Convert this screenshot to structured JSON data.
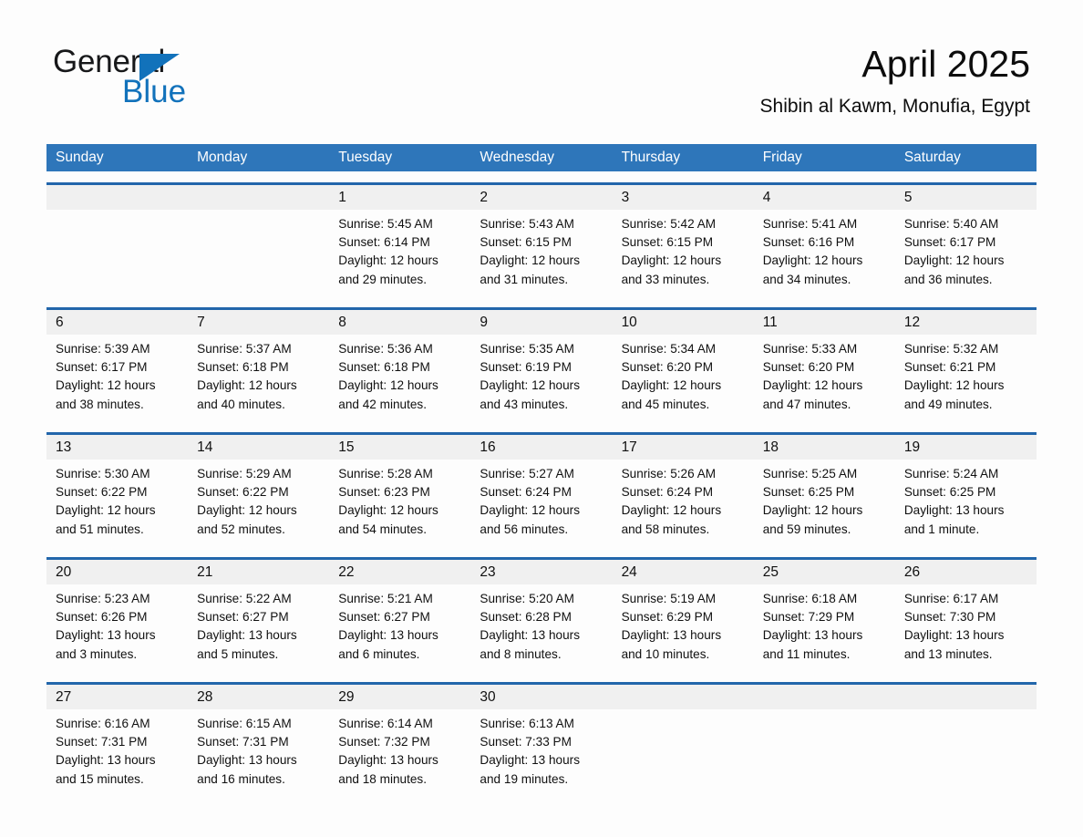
{
  "brand": {
    "name_part1": "General",
    "name_part2": "Blue",
    "accent_color": "#1272bb",
    "logo_icon": "triangle-flag-icon"
  },
  "header": {
    "title": "April 2025",
    "subtitle": "Shibin al Kawm, Monufia, Egypt"
  },
  "theme": {
    "header_bar_color": "#2e76ba",
    "week_rule_color": "#2266ab",
    "daynum_row_color": "#f0f0f0",
    "page_background": "#fdfdfd"
  },
  "weekdays": [
    "Sunday",
    "Monday",
    "Tuesday",
    "Wednesday",
    "Thursday",
    "Friday",
    "Saturday"
  ],
  "weeks": [
    {
      "days": [
        {
          "num": "",
          "l1": "",
          "l2": "",
          "l3": "",
          "l4": "",
          "empty": true
        },
        {
          "num": "",
          "l1": "",
          "l2": "",
          "l3": "",
          "l4": "",
          "empty": true
        },
        {
          "num": "1",
          "l1": "Sunrise: 5:45 AM",
          "l2": "Sunset: 6:14 PM",
          "l3": "Daylight: 12 hours",
          "l4": "and 29 minutes.",
          "empty": false
        },
        {
          "num": "2",
          "l1": "Sunrise: 5:43 AM",
          "l2": "Sunset: 6:15 PM",
          "l3": "Daylight: 12 hours",
          "l4": "and 31 minutes.",
          "empty": false
        },
        {
          "num": "3",
          "l1": "Sunrise: 5:42 AM",
          "l2": "Sunset: 6:15 PM",
          "l3": "Daylight: 12 hours",
          "l4": "and 33 minutes.",
          "empty": false
        },
        {
          "num": "4",
          "l1": "Sunrise: 5:41 AM",
          "l2": "Sunset: 6:16 PM",
          "l3": "Daylight: 12 hours",
          "l4": "and 34 minutes.",
          "empty": false
        },
        {
          "num": "5",
          "l1": "Sunrise: 5:40 AM",
          "l2": "Sunset: 6:17 PM",
          "l3": "Daylight: 12 hours",
          "l4": "and 36 minutes.",
          "empty": false
        }
      ]
    },
    {
      "days": [
        {
          "num": "6",
          "l1": "Sunrise: 5:39 AM",
          "l2": "Sunset: 6:17 PM",
          "l3": "Daylight: 12 hours",
          "l4": "and 38 minutes.",
          "empty": false
        },
        {
          "num": "7",
          "l1": "Sunrise: 5:37 AM",
          "l2": "Sunset: 6:18 PM",
          "l3": "Daylight: 12 hours",
          "l4": "and 40 minutes.",
          "empty": false
        },
        {
          "num": "8",
          "l1": "Sunrise: 5:36 AM",
          "l2": "Sunset: 6:18 PM",
          "l3": "Daylight: 12 hours",
          "l4": "and 42 minutes.",
          "empty": false
        },
        {
          "num": "9",
          "l1": "Sunrise: 5:35 AM",
          "l2": "Sunset: 6:19 PM",
          "l3": "Daylight: 12 hours",
          "l4": "and 43 minutes.",
          "empty": false
        },
        {
          "num": "10",
          "l1": "Sunrise: 5:34 AM",
          "l2": "Sunset: 6:20 PM",
          "l3": "Daylight: 12 hours",
          "l4": "and 45 minutes.",
          "empty": false
        },
        {
          "num": "11",
          "l1": "Sunrise: 5:33 AM",
          "l2": "Sunset: 6:20 PM",
          "l3": "Daylight: 12 hours",
          "l4": "and 47 minutes.",
          "empty": false
        },
        {
          "num": "12",
          "l1": "Sunrise: 5:32 AM",
          "l2": "Sunset: 6:21 PM",
          "l3": "Daylight: 12 hours",
          "l4": "and 49 minutes.",
          "empty": false
        }
      ]
    },
    {
      "days": [
        {
          "num": "13",
          "l1": "Sunrise: 5:30 AM",
          "l2": "Sunset: 6:22 PM",
          "l3": "Daylight: 12 hours",
          "l4": "and 51 minutes.",
          "empty": false
        },
        {
          "num": "14",
          "l1": "Sunrise: 5:29 AM",
          "l2": "Sunset: 6:22 PM",
          "l3": "Daylight: 12 hours",
          "l4": "and 52 minutes.",
          "empty": false
        },
        {
          "num": "15",
          "l1": "Sunrise: 5:28 AM",
          "l2": "Sunset: 6:23 PM",
          "l3": "Daylight: 12 hours",
          "l4": "and 54 minutes.",
          "empty": false
        },
        {
          "num": "16",
          "l1": "Sunrise: 5:27 AM",
          "l2": "Sunset: 6:24 PM",
          "l3": "Daylight: 12 hours",
          "l4": "and 56 minutes.",
          "empty": false
        },
        {
          "num": "17",
          "l1": "Sunrise: 5:26 AM",
          "l2": "Sunset: 6:24 PM",
          "l3": "Daylight: 12 hours",
          "l4": "and 58 minutes.",
          "empty": false
        },
        {
          "num": "18",
          "l1": "Sunrise: 5:25 AM",
          "l2": "Sunset: 6:25 PM",
          "l3": "Daylight: 12 hours",
          "l4": "and 59 minutes.",
          "empty": false
        },
        {
          "num": "19",
          "l1": "Sunrise: 5:24 AM",
          "l2": "Sunset: 6:25 PM",
          "l3": "Daylight: 13 hours",
          "l4": "and 1 minute.",
          "empty": false
        }
      ]
    },
    {
      "days": [
        {
          "num": "20",
          "l1": "Sunrise: 5:23 AM",
          "l2": "Sunset: 6:26 PM",
          "l3": "Daylight: 13 hours",
          "l4": "and 3 minutes.",
          "empty": false
        },
        {
          "num": "21",
          "l1": "Sunrise: 5:22 AM",
          "l2": "Sunset: 6:27 PM",
          "l3": "Daylight: 13 hours",
          "l4": "and 5 minutes.",
          "empty": false
        },
        {
          "num": "22",
          "l1": "Sunrise: 5:21 AM",
          "l2": "Sunset: 6:27 PM",
          "l3": "Daylight: 13 hours",
          "l4": "and 6 minutes.",
          "empty": false
        },
        {
          "num": "23",
          "l1": "Sunrise: 5:20 AM",
          "l2": "Sunset: 6:28 PM",
          "l3": "Daylight: 13 hours",
          "l4": "and 8 minutes.",
          "empty": false
        },
        {
          "num": "24",
          "l1": "Sunrise: 5:19 AM",
          "l2": "Sunset: 6:29 PM",
          "l3": "Daylight: 13 hours",
          "l4": "and 10 minutes.",
          "empty": false
        },
        {
          "num": "25",
          "l1": "Sunrise: 6:18 AM",
          "l2": "Sunset: 7:29 PM",
          "l3": "Daylight: 13 hours",
          "l4": "and 11 minutes.",
          "empty": false
        },
        {
          "num": "26",
          "l1": "Sunrise: 6:17 AM",
          "l2": "Sunset: 7:30 PM",
          "l3": "Daylight: 13 hours",
          "l4": "and 13 minutes.",
          "empty": false
        }
      ]
    },
    {
      "days": [
        {
          "num": "27",
          "l1": "Sunrise: 6:16 AM",
          "l2": "Sunset: 7:31 PM",
          "l3": "Daylight: 13 hours",
          "l4": "and 15 minutes.",
          "empty": false
        },
        {
          "num": "28",
          "l1": "Sunrise: 6:15 AM",
          "l2": "Sunset: 7:31 PM",
          "l3": "Daylight: 13 hours",
          "l4": "and 16 minutes.",
          "empty": false
        },
        {
          "num": "29",
          "l1": "Sunrise: 6:14 AM",
          "l2": "Sunset: 7:32 PM",
          "l3": "Daylight: 13 hours",
          "l4": "and 18 minutes.",
          "empty": false
        },
        {
          "num": "30",
          "l1": "Sunrise: 6:13 AM",
          "l2": "Sunset: 7:33 PM",
          "l3": "Daylight: 13 hours",
          "l4": "and 19 minutes.",
          "empty": false
        },
        {
          "num": "",
          "l1": "",
          "l2": "",
          "l3": "",
          "l4": "",
          "empty": true
        },
        {
          "num": "",
          "l1": "",
          "l2": "",
          "l3": "",
          "l4": "",
          "empty": true
        },
        {
          "num": "",
          "l1": "",
          "l2": "",
          "l3": "",
          "l4": "",
          "empty": true
        }
      ]
    }
  ]
}
